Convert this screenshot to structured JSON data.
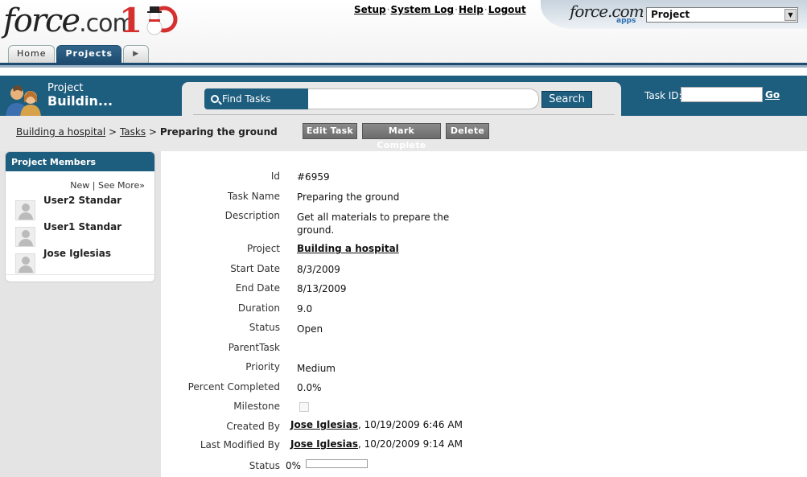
{
  "brand": {
    "logo": "force.com",
    "app_logo": "force.com",
    "apps_label": "apps"
  },
  "tabs": [
    {
      "label": "Home"
    },
    {
      "label": "Projects"
    },
    {
      "label": "▶"
    }
  ],
  "top_links": {
    "setup": "Setup",
    "system_log": "System Log",
    "help": "Help",
    "logout": "Logout",
    "separator": "·"
  },
  "app_selector": {
    "value": "Project",
    "arrow": "▼"
  },
  "header": {
    "object_type": "Project",
    "record_name": "Buildin..."
  },
  "search": {
    "label": "Find Tasks",
    "value": "",
    "button": "Search"
  },
  "task_id": {
    "label": "Task ID:",
    "value": "",
    "go": "Go"
  },
  "breadcrumb": {
    "project": "Building a hospital",
    "sep1": ">",
    "tasks": "Tasks",
    "sep2": ">",
    "current": "Preparing the ground"
  },
  "actions": {
    "edit": "Edit Task",
    "complete": "Mark Complete",
    "delete": "Delete"
  },
  "members": {
    "title": "Project Members",
    "new_link": "New",
    "link_sep": "|",
    "see_more": "See More»",
    "items": [
      {
        "name": "User2 Standar"
      },
      {
        "name": "User1 Standar"
      },
      {
        "name": "Jose Iglesias"
      }
    ]
  },
  "details": {
    "id": {
      "label": "Id",
      "value": "#6959"
    },
    "task_name": {
      "label": "Task Name",
      "value": "Preparing the ground"
    },
    "description": {
      "label": "Description",
      "value": "Get all materials to prepare the ground."
    },
    "project": {
      "label": "Project",
      "value": "Building a hospital"
    },
    "start_date": {
      "label": "Start Date",
      "value": "8/3/2009"
    },
    "end_date": {
      "label": "End Date",
      "value": "8/13/2009"
    },
    "duration": {
      "label": "Duration",
      "value": "9.0"
    },
    "status": {
      "label": "Status",
      "value": "Open"
    },
    "parent_task": {
      "label": "ParentTask",
      "value": ""
    },
    "priority": {
      "label": "Priority",
      "value": "Medium"
    },
    "percent_completed": {
      "label": "Percent Completed",
      "value": "0.0%"
    },
    "milestone": {
      "label": "Milestone",
      "checked": false
    },
    "created_by": {
      "label": "Created By",
      "user": "Jose Iglesias",
      "date": ", 10/19/2009 6:46 AM"
    },
    "last_modified_by": {
      "label": "Last Modified By",
      "user": "Jose Iglesias",
      "date": ", 10/20/2009 9:14 AM"
    },
    "status_bar": {
      "label": "Status",
      "percent_text": "0%",
      "fraction": 0.0
    }
  },
  "colors": {
    "primary": "#1d5d7e",
    "button_gray": "#7a7a7a",
    "sidebar_bg": "#e4e4e4"
  },
  "icons": [
    "search-icon",
    "project-members-icon",
    "user-avatar-icon",
    "anniversary-snowman-icon"
  ]
}
